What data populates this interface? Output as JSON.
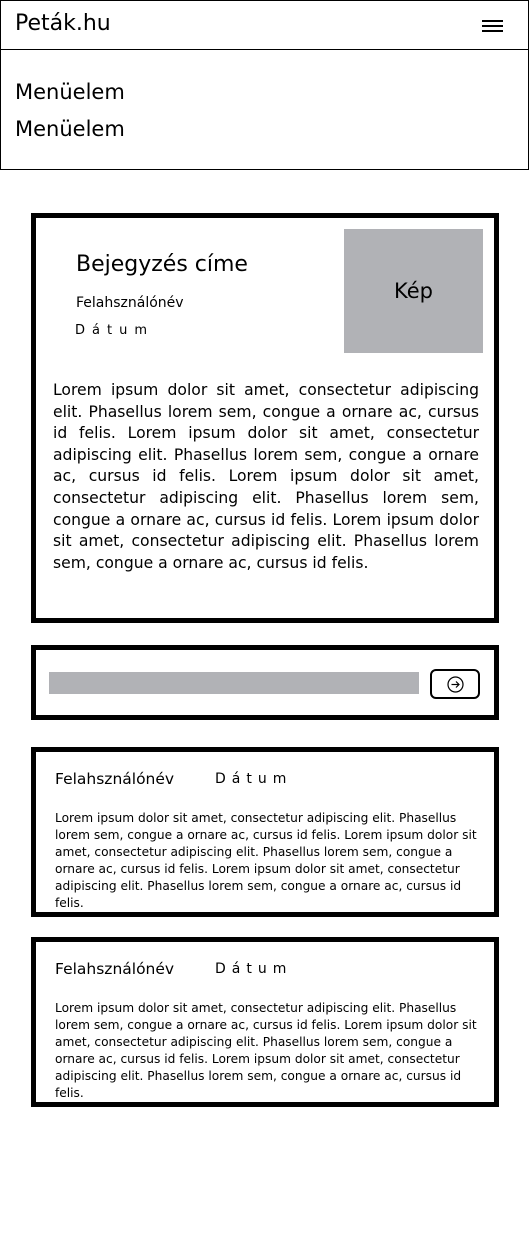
{
  "header": {
    "brand": "Peták.hu",
    "menu_icon": "hamburger-menu-icon"
  },
  "menu": {
    "items": [
      {
        "label": "Menüelem"
      },
      {
        "label": "Menüelem"
      }
    ]
  },
  "post": {
    "title": "Bejegyzés címe",
    "username": "Felahsználónév",
    "date": "Dátum",
    "image_label": "Kép",
    "body": "Lorem ipsum dolor sit amet, consectetur adipiscing elit. Phasellus lorem sem, congue a ornare ac, cursus id felis.  Lorem ipsum dolor sit amet, consectetur adipiscing elit. Phasellus lorem sem, congue a ornare ac, cursus id felis.  Lorem ipsum dolor sit amet, consectetur adipiscing elit. Phasellus lorem sem, congue a ornare ac, cursus id felis.   Lorem ipsum dolor sit amet, consectetur adipiscing elit. Phasellus lorem sem, congue a ornare ac, cursus id felis."
  },
  "comment_form": {
    "input_value": "",
    "send_icon": "arrow-right-circle-icon"
  },
  "comments": [
    {
      "username": "Felahsználónév",
      "date": "Dátum",
      "body": "Lorem ipsum dolor sit amet, consectetur adipiscing elit. Phasellus lorem sem, congue a ornare ac, cursus id felis. Lorem ipsum dolor sit amet, consectetur adipiscing elit. Phasellus lorem sem, congue a ornare ac, cursus id felis. Lorem ipsum dolor sit amet, consectetur adipiscing elit. Phasellus lorem sem, congue a ornare ac, cursus id felis."
    },
    {
      "username": "Felahsználónév",
      "date": "Dátum",
      "body": "Lorem ipsum dolor sit amet, consectetur adipiscing elit. Phasellus lorem sem, congue a ornare ac, cursus id felis. Lorem ipsum dolor sit amet, consectetur adipiscing elit. Phasellus lorem sem, congue a ornare ac, cursus id felis. Lorem ipsum dolor sit amet, consectetur adipiscing elit. Phasellus lorem sem, congue a ornare ac, cursus id felis."
    }
  ],
  "colors": {
    "placeholder_gray": "#b1b2b6",
    "border": "#000000",
    "background": "#ffffff"
  }
}
